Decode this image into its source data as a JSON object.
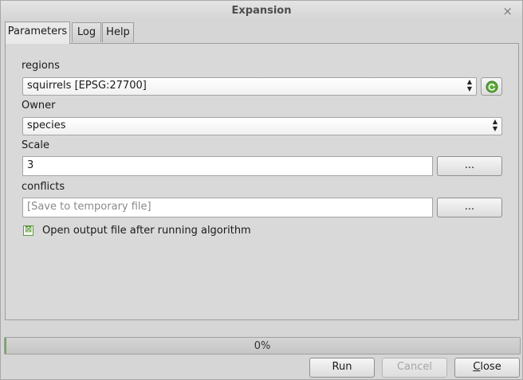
{
  "window": {
    "title": "Expansion",
    "close_glyph": "×"
  },
  "tabs": [
    {
      "label": "Parameters",
      "active": true
    },
    {
      "label": "Log",
      "active": false
    },
    {
      "label": "Help",
      "active": false
    }
  ],
  "params": {
    "regions": {
      "label": "regions",
      "value": "squirrels [EPSG:27700]",
      "refresh_icon": "refresh-icon"
    },
    "owner": {
      "label": "Owner",
      "value": "species"
    },
    "scale": {
      "label": "Scale",
      "value": "3",
      "browse_label": "..."
    },
    "conflicts": {
      "label": "conflicts",
      "placeholder": "[Save to temporary file]",
      "browse_label": "..."
    },
    "open_output": {
      "label": "Open output file after running algorithm",
      "checked": true
    }
  },
  "progress": {
    "value_percent": 0,
    "text": "0%",
    "fill_color": "#6ab04c"
  },
  "buttons": {
    "run": "Run",
    "cancel": "Cancel",
    "close_first": "C",
    "close_rest": "lose"
  }
}
